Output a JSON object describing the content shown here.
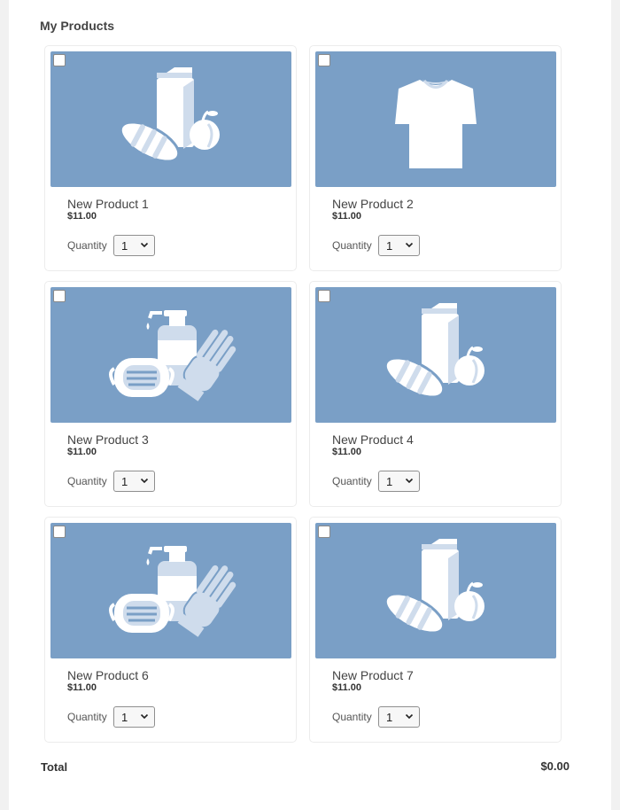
{
  "section_title": "My Products",
  "colors": {
    "image_bg": "#7a9fc6",
    "icon_light": "#ffffff",
    "icon_pale": "#cfdcec"
  },
  "products": [
    {
      "name": "New Product 1",
      "price": "$11.00",
      "quantity_label": "Quantity",
      "quantity": "1",
      "checked": false,
      "icon": "grocery-icon"
    },
    {
      "name": "New Product 2",
      "price": "$11.00",
      "quantity_label": "Quantity",
      "quantity": "1",
      "checked": false,
      "icon": "tshirt-icon"
    },
    {
      "name": "New Product 3",
      "price": "$11.00",
      "quantity_label": "Quantity",
      "quantity": "1",
      "checked": false,
      "icon": "ppe-icon"
    },
    {
      "name": "New Product 4",
      "price": "$11.00",
      "quantity_label": "Quantity",
      "quantity": "1",
      "checked": false,
      "icon": "grocery-icon"
    },
    {
      "name": "New Product 6",
      "price": "$11.00",
      "quantity_label": "Quantity",
      "quantity": "1",
      "checked": false,
      "icon": "ppe-icon"
    },
    {
      "name": "New Product 7",
      "price": "$11.00",
      "quantity_label": "Quantity",
      "quantity": "1",
      "checked": false,
      "icon": "grocery-icon"
    }
  ],
  "total": {
    "label": "Total",
    "value": "$0.00"
  }
}
